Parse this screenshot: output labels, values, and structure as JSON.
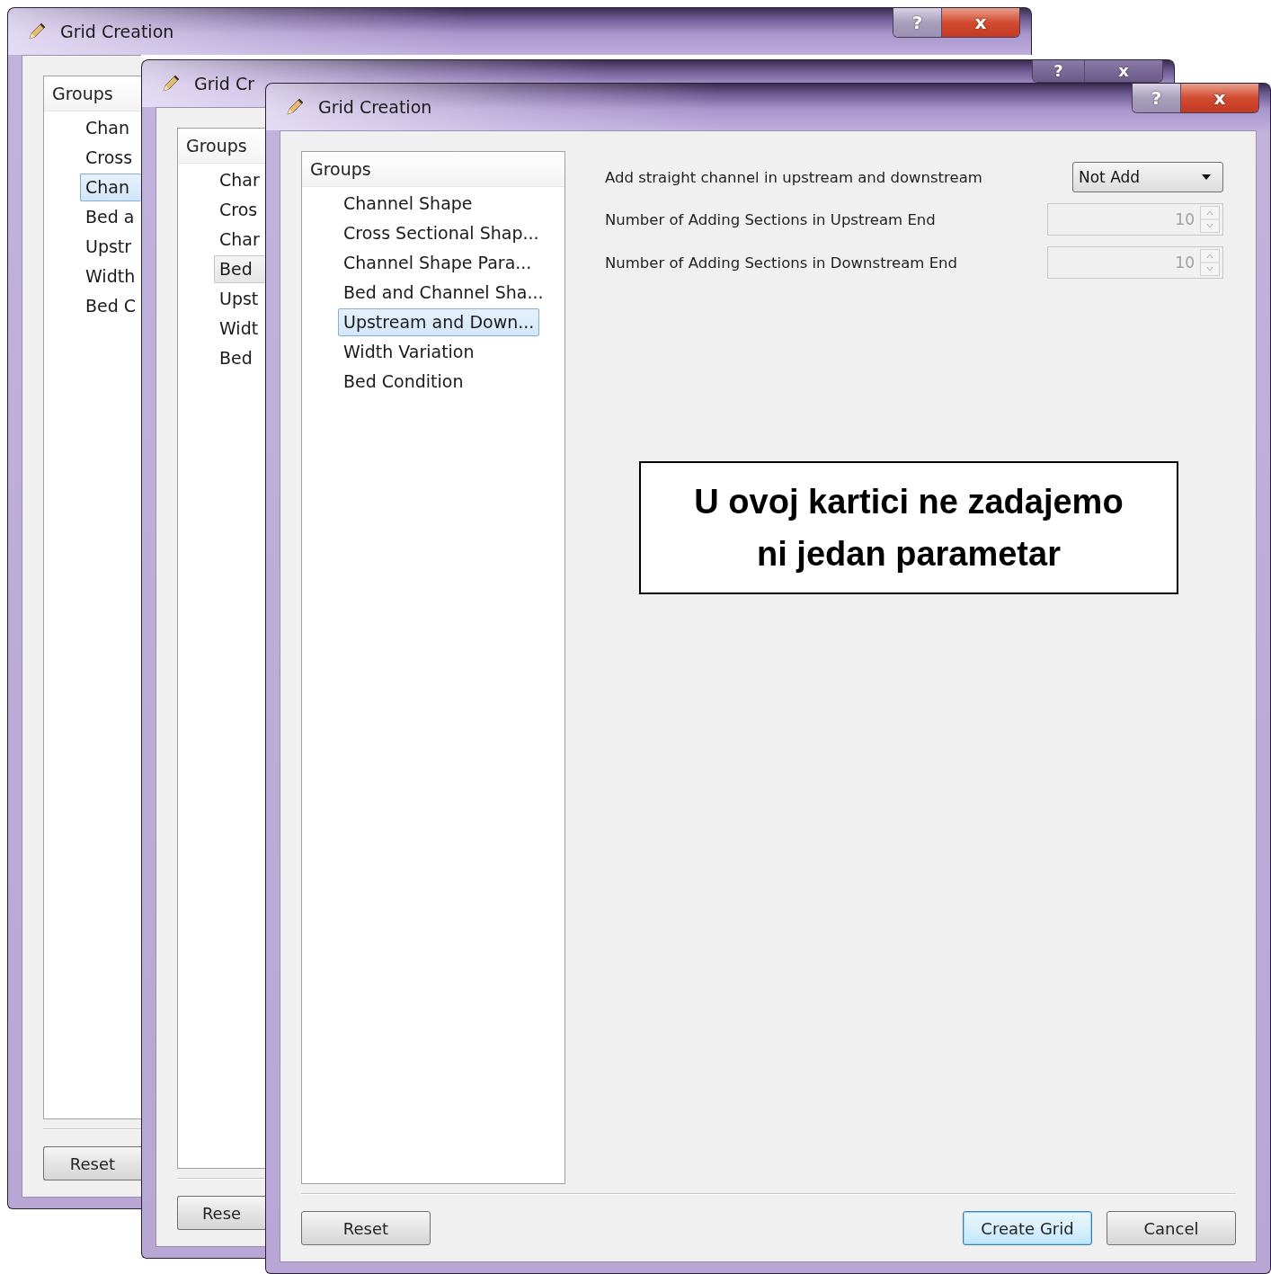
{
  "windows": [
    {
      "title": "Grid Creation",
      "help_button": "?",
      "close_button": "x",
      "groups_header": "Groups",
      "list_focused": true,
      "groups": [
        {
          "label": "Chan",
          "selected": false
        },
        {
          "label": "Cross",
          "selected": false
        },
        {
          "label": "Chan",
          "selected": true
        },
        {
          "label": "Bed a",
          "selected": false
        },
        {
          "label": "Upstr",
          "selected": false
        },
        {
          "label": "Width",
          "selected": false
        },
        {
          "label": "Bed C",
          "selected": false
        }
      ],
      "reset_button": "Reset"
    },
    {
      "title": "Grid Cr",
      "help_button": "?",
      "close_button": "x",
      "groups_header": "Groups",
      "list_focused": false,
      "groups": [
        {
          "label": "Char",
          "selected": false
        },
        {
          "label": "Cros",
          "selected": false
        },
        {
          "label": "Char",
          "selected": false
        },
        {
          "label": "Bed",
          "selected": true
        },
        {
          "label": "Upst",
          "selected": false
        },
        {
          "label": "Widt",
          "selected": false
        },
        {
          "label": "Bed",
          "selected": false
        }
      ],
      "reset_button": "Rese"
    },
    {
      "title": "Grid Creation",
      "help_button": "?",
      "close_button": "x",
      "groups_header": "Groups",
      "list_focused": true,
      "groups": [
        {
          "label": "Channel Shape",
          "selected": false
        },
        {
          "label": "Cross Sectional Shap...",
          "selected": false
        },
        {
          "label": "Channel Shape Para...",
          "selected": false
        },
        {
          "label": "Bed and Channel Sha...",
          "selected": false
        },
        {
          "label": "Upstream and Down...",
          "selected": true
        },
        {
          "label": "Width Variation",
          "selected": false
        },
        {
          "label": "Bed Condition",
          "selected": false
        }
      ],
      "reset_button": "Reset",
      "fields": [
        {
          "kind": "combo",
          "label": "Add straight channel in upstream and downstream",
          "value": "Not Add",
          "disabled": false
        },
        {
          "kind": "spin",
          "label": "Number of Adding Sections in Upstream End",
          "value": "10",
          "disabled": true
        },
        {
          "kind": "spin",
          "label": "Number of Adding Sections in Downstream End",
          "value": "10",
          "disabled": true
        }
      ],
      "annotation": {
        "lines": [
          "U ovoj kartici ne zadajemo",
          "ni jedan parametar"
        ]
      },
      "buttons": [
        {
          "label": "Create Grid",
          "default": true
        },
        {
          "label": "Cancel",
          "default": false
        }
      ]
    }
  ]
}
